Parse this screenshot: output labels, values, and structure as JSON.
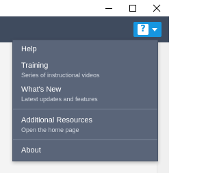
{
  "window": {
    "minimize_icon": "minimize-icon",
    "maximize_icon": "maximize-icon",
    "close_icon": "close-icon"
  },
  "toolbar": {
    "help_glyph": "?",
    "help_icon": "question-mark-icon",
    "caret_icon": "chevron-down-icon",
    "help_button_color": "#1696e0",
    "bar_color": "#3f4b5e"
  },
  "menu": {
    "background_color": "#5a6579",
    "items": [
      {
        "label": "Help",
        "sub": ""
      },
      {
        "label": "Training",
        "sub": "Series of instructional videos"
      },
      {
        "label": "What's New",
        "sub": "Latest updates and features"
      },
      {
        "label": "Additional Resources",
        "sub": "Open the home page"
      },
      {
        "label": "About",
        "sub": ""
      }
    ]
  }
}
